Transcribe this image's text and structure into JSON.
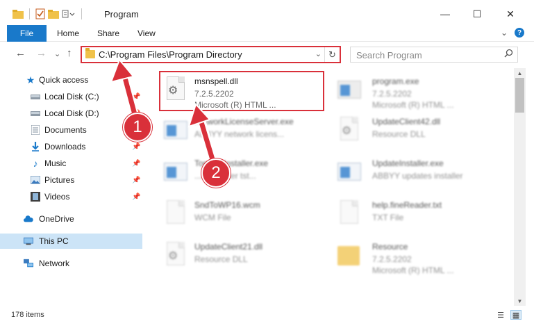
{
  "window": {
    "title": "Program",
    "minimize": "—",
    "maximize": "☐",
    "close": "✕"
  },
  "ribbon": {
    "tabs": [
      "File",
      "Home",
      "Share",
      "View"
    ],
    "expand": "⌄",
    "help": "?"
  },
  "nav": {
    "back": "←",
    "forward": "→",
    "recent": "⌄",
    "up": "↑",
    "address": "C:\\Program Files\\Program Directory",
    "address_dropdown": "⌄",
    "refresh": "↻",
    "search_placeholder": "Search Program",
    "search_icon": "🔍"
  },
  "sidebar": {
    "items": [
      {
        "label": "Quick access",
        "icon": "star-icon",
        "pinned": false
      },
      {
        "label": "Local Disk (C:)",
        "icon": "drive-icon",
        "pinned": true
      },
      {
        "label": "Local Disk (D:)",
        "icon": "drive-icon",
        "pinned": true
      },
      {
        "label": "Documents",
        "icon": "documents-icon",
        "pinned": true
      },
      {
        "label": "Downloads",
        "icon": "download-icon",
        "pinned": true
      },
      {
        "label": "Music",
        "icon": "music-icon",
        "pinned": true
      },
      {
        "label": "Pictures",
        "icon": "pictures-icon",
        "pinned": true
      },
      {
        "label": "Videos",
        "icon": "videos-icon",
        "pinned": true
      },
      {
        "label": "OneDrive",
        "icon": "cloud-icon",
        "pinned": false
      },
      {
        "label": "This PC",
        "icon": "computer-icon",
        "pinned": false
      },
      {
        "label": "Network",
        "icon": "network-icon",
        "pinned": false
      }
    ],
    "pin_glyph": "📌"
  },
  "files": [
    {
      "name": "msnspell.dll",
      "line2": "7.2.5.2202",
      "line3": "Microsoft (R) HTML ...",
      "icon": "dll-icon",
      "highlighted": true
    },
    {
      "name": "program.exe",
      "line2": "7.2.5.2202",
      "line3": "Microsoft (R) HTML ...",
      "icon": "exe-icon",
      "highlighted": false
    },
    {
      "name": "NetworkLicenseServer.exe",
      "line2": "ABBYY network licens...",
      "line3": "",
      "icon": "exe-icon",
      "highlighted": false
    },
    {
      "name": "UpdateClient42.dll",
      "line2": "Resource DLL",
      "line3": "",
      "icon": "dll-icon",
      "highlighted": false
    },
    {
      "name": "TomonsInstaller.exe",
      "line2": "...neReader tst...",
      "line3": "",
      "icon": "exe-icon",
      "highlighted": false
    },
    {
      "name": "UpdateInstaller.exe",
      "line2": "ABBYY updates installer",
      "line3": "",
      "icon": "exe-icon",
      "highlighted": false
    },
    {
      "name": "SndToWP16.wcm",
      "line2": "WCM File",
      "line3": "",
      "icon": "file-icon",
      "highlighted": false
    },
    {
      "name": "help.fineReader.txt",
      "line2": "TXT File",
      "line3": "",
      "icon": "file-icon",
      "highlighted": false
    },
    {
      "name": "UpdateClient21.dll",
      "line2": "Resource DLL",
      "line3": "",
      "icon": "dll-icon",
      "highlighted": false
    },
    {
      "name": "Resource",
      "line2": "7.2.5.2202",
      "line3": "Microsoft (R) HTML ...",
      "icon": "folder-icon",
      "highlighted": false
    }
  ],
  "annotations": {
    "step1": "1",
    "step2": "2",
    "accent": "#d9303a"
  },
  "status": {
    "count": "178 items"
  },
  "colors": {
    "ribbon_file": "#1979ca",
    "selection": "#cce4f7"
  }
}
